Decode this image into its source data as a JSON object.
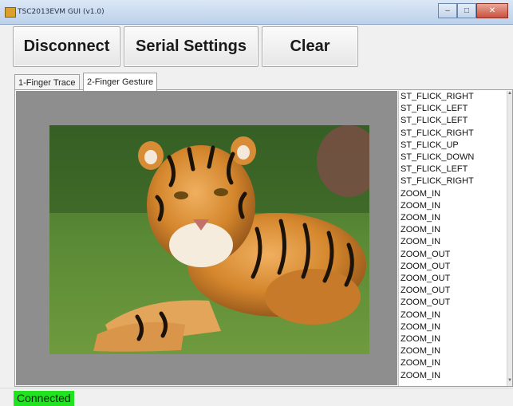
{
  "window": {
    "title": "TSC2013EVM GUI (v1.0)",
    "controls": [
      "–",
      "□",
      "✕"
    ]
  },
  "toolbar": {
    "disconnect_label": "Disconnect",
    "serial_settings_label": "Serial Settings",
    "clear_label": "Clear"
  },
  "tabs": [
    {
      "label": "1-Finger Trace",
      "active": false
    },
    {
      "label": "2-Finger Gesture",
      "active": true
    }
  ],
  "gesture_log": [
    "ST_FLICK_RIGHT",
    "ST_FLICK_LEFT",
    "ST_FLICK_LEFT",
    "ST_FLICK_RIGHT",
    "ST_FLICK_UP",
    "ST_FLICK_DOWN",
    "ST_FLICK_LEFT",
    "ST_FLICK_RIGHT",
    "ZOOM_IN",
    "ZOOM_IN",
    "ZOOM_IN",
    "ZOOM_IN",
    "ZOOM_IN",
    "ZOOM_OUT",
    "ZOOM_OUT",
    "ZOOM_OUT",
    "ZOOM_OUT",
    "ZOOM_OUT",
    "ZOOM_IN",
    "ZOOM_IN",
    "ZOOM_IN",
    "ZOOM_IN",
    "ZOOM_IN",
    "ZOOM_IN"
  ],
  "status": {
    "text": "Connected",
    "color": "#22e322"
  }
}
